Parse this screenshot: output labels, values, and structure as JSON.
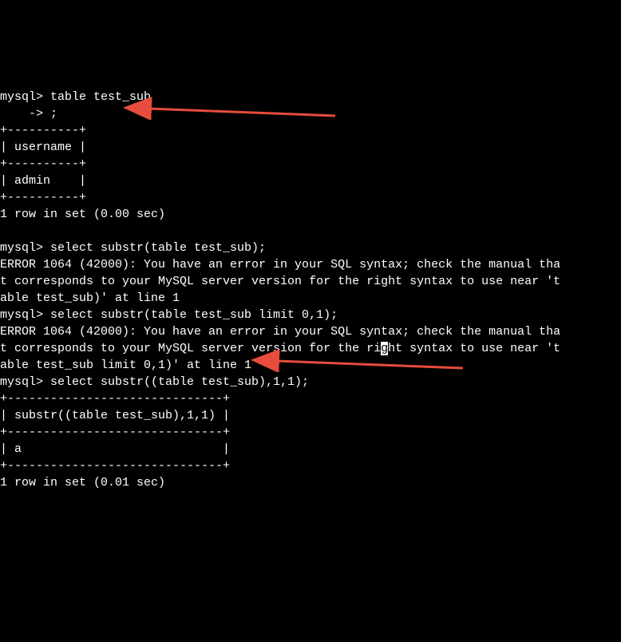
{
  "terminal": {
    "lines": [
      "mysql> table test_sub",
      "    -> ;",
      "+----------+",
      "| username |",
      "+----------+",
      "| admin    |",
      "+----------+",
      "1 row in set (0.00 sec)",
      "",
      "mysql> select substr(table test_sub);",
      "ERROR 1064 (42000): You have an error in your SQL syntax; check the manual tha",
      "t corresponds to your MySQL server version for the right syntax to use near 't",
      "able test_sub)' at line 1",
      "mysql> select substr(table test_sub limit 0,1);",
      "ERROR 1064 (42000): You have an error in your SQL syntax; check the manual tha",
      "t corresponds to your MySQL server version for the ri",
      "g",
      "ht syntax to use near 't",
      "able test_sub limit 0,1)' at line 1",
      "mysql> select substr((table test_sub),1,1);",
      "+------------------------------+",
      "| substr((table test_sub),1,1) |",
      "+------------------------------+",
      "| a                            |",
      "+------------------------------+",
      "1 row in set (0.01 sec)"
    ]
  },
  "annotations": {
    "arrow_color": "#e74c3c"
  }
}
